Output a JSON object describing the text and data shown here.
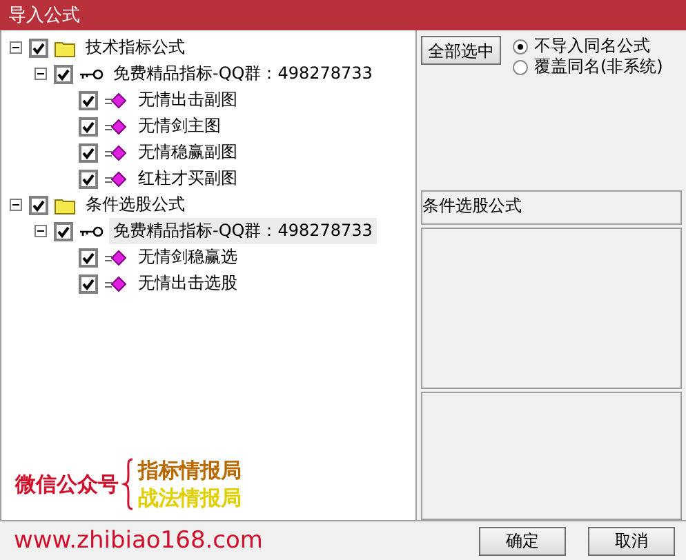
{
  "window": {
    "title": "导入公式"
  },
  "tree": [
    {
      "kind": "folder",
      "label": "技术指标公式",
      "checked": true,
      "expanded": true,
      "selected": false,
      "children": [
        {
          "kind": "group",
          "label": "免费精品指标-QQ群：498278733",
          "checked": true,
          "expanded": true,
          "selected": false,
          "children": [
            {
              "kind": "formula",
              "label": "无情出击副图",
              "checked": true,
              "selected": false
            },
            {
              "kind": "formula",
              "label": "无情剑主图",
              "checked": true,
              "selected": false
            },
            {
              "kind": "formula",
              "label": "无情稳赢副图",
              "checked": true,
              "selected": false
            },
            {
              "kind": "formula",
              "label": "红柱才买副图",
              "checked": true,
              "selected": false
            }
          ]
        }
      ]
    },
    {
      "kind": "folder",
      "label": "条件选股公式",
      "checked": true,
      "expanded": true,
      "selected": false,
      "children": [
        {
          "kind": "group",
          "label": "免费精品指标-QQ群：498278733",
          "checked": true,
          "expanded": true,
          "selected": true,
          "children": [
            {
              "kind": "formula",
              "label": "无情剑稳赢选",
              "checked": true,
              "selected": false
            },
            {
              "kind": "formula",
              "label": "无情出击选股",
              "checked": true,
              "selected": false
            }
          ]
        }
      ]
    }
  ],
  "promo": {
    "account_label": "微信公众号",
    "accounts": [
      "指标情报局",
      "战法情报局"
    ],
    "url": "www.zhibiao168.com"
  },
  "select_all_button": "全部选中",
  "options": [
    {
      "label": "不导入同名公式",
      "selected": true
    },
    {
      "label": "覆盖同名(非系统)",
      "selected": false
    }
  ],
  "info_box": {
    "text": "条件选股公式"
  },
  "buttons": [
    "确定",
    "取消"
  ]
}
